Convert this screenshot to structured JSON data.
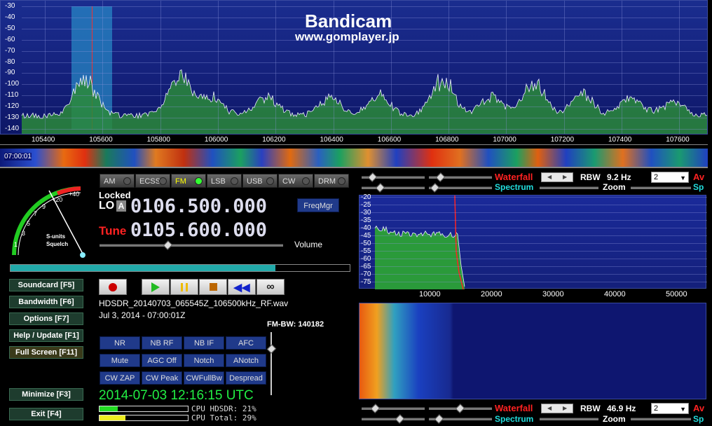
{
  "watermark": {
    "title": "Bandicam",
    "url": "www.gomplayer.jp"
  },
  "top_spectrum": {
    "y_labels": [
      "-30",
      "-40",
      "-50",
      "-60",
      "-70",
      "-80",
      "-90",
      "-100",
      "-110",
      "-120",
      "-130",
      "-140"
    ],
    "x_labels": [
      "105400",
      "105600",
      "105800",
      "106000",
      "106200",
      "106400",
      "106600",
      "106800",
      "107000",
      "107200",
      "107400",
      "107600"
    ]
  },
  "waterfall_strip": {
    "time": "07:00:01"
  },
  "s_meter": {
    "scale": [
      "1",
      "3",
      "5",
      "7",
      "9",
      "+20",
      "+40"
    ],
    "label1": "S-units",
    "label2": "Squelch"
  },
  "modes": [
    {
      "label": "AM",
      "active": false
    },
    {
      "label": "ECSS",
      "active": false
    },
    {
      "label": "FM",
      "active": true
    },
    {
      "label": "LSB",
      "active": false
    },
    {
      "label": "USB",
      "active": false
    },
    {
      "label": "CW",
      "active": false
    },
    {
      "label": "DRM",
      "active": false
    }
  ],
  "lo": {
    "locked": "Locked",
    "label": "LO",
    "a": "A",
    "freq": "0106.500.000"
  },
  "tune": {
    "label": "Tune",
    "freq": "0105.600.000"
  },
  "freqmgr": "FreqMgr",
  "volume": "Volume",
  "nav_buttons": [
    {
      "label": "Soundcard  [F5]"
    },
    {
      "label": "Bandwidth  [F6]"
    },
    {
      "label": "Options  [F7]"
    },
    {
      "label": "Help / Update  [F1]"
    },
    {
      "label": "Full Screen  [F11]"
    },
    {
      "label": "Minimize  [F3]"
    },
    {
      "label": "Exit  [F4]"
    }
  ],
  "file": {
    "name": "HDSDR_20140703_065545Z_106500kHz_RF.wav",
    "date": "Jul 3, 2014 - 07:00:01Z"
  },
  "fm_bw": "FM-BW: 140182",
  "dsp_buttons": [
    [
      "NR",
      "NB RF",
      "NB IF",
      "AFC"
    ],
    [
      "Mute",
      "AGC Off",
      "Notch",
      "ANotch"
    ],
    [
      "CW ZAP",
      "CW Peak",
      "CWFullBw",
      "Despread"
    ]
  ],
  "clock": "2014-07-03  12:16:15 UTC",
  "cpu": {
    "hdsdr": "CPU HDSDR: 21%",
    "total": "CPU Total: 29%",
    "hdsdr_level": 0.21,
    "total_level": 0.29
  },
  "rf_panel": {
    "waterfall": "Waterfall",
    "spectrum": "Spectrum",
    "rbw": "RBW",
    "rbw_val": "9.2 Hz",
    "zoom": "Zoom",
    "combo": "2",
    "av": "Av",
    "sp": "Sp"
  },
  "af_spectrum": {
    "y_labels": [
      "-20",
      "-25",
      "-30",
      "-35",
      "-40",
      "-45",
      "-50",
      "-55",
      "-60",
      "-65",
      "-70",
      "-75"
    ],
    "x_labels": [
      "10000",
      "20000",
      "30000",
      "40000",
      "50000"
    ]
  },
  "af_panel": {
    "waterfall": "Waterfall",
    "spectrum": "Spectrum",
    "rbw": "RBW",
    "rbw_val": "46.9 Hz",
    "zoom": "Zoom",
    "combo": "2",
    "av": "Av",
    "sp": "Sp"
  },
  "colors": {
    "accent_red": "#ff2222",
    "accent_cyan": "#22dddd",
    "clock_green": "#22ee44"
  }
}
